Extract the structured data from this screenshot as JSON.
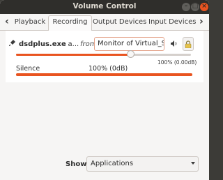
{
  "window": {
    "title": "Volume Control"
  },
  "tabs": [
    {
      "label": "Playback"
    },
    {
      "label": "Recording",
      "selected": true
    },
    {
      "label": "Output Devices"
    },
    {
      "label": "Input Devices"
    }
  ],
  "stream": {
    "name": "dsdplus.exe",
    "name_suffix": ": a...",
    "from_label": "from",
    "source": "Monitor of Virtual_Sink",
    "volume_percent": 100,
    "volume_readout": "100% (0.00dB)",
    "slider_max_percent": 153,
    "scale_left_label": "Silence",
    "scale_mid_label": "100% (0dB)",
    "level_fraction": 1.0
  },
  "footer": {
    "show_label": "Show:",
    "show_value": "Applications"
  },
  "colors": {
    "accent": "#e95420",
    "titlebar": "#2f2e2b"
  },
  "icons": [
    "microphone-icon",
    "speaker-icon",
    "lock-icon",
    "minimize-icon",
    "maximize-icon",
    "close-icon",
    "chevron-left-icon",
    "chevron-right-icon",
    "dropdown-arrow-icon"
  ]
}
